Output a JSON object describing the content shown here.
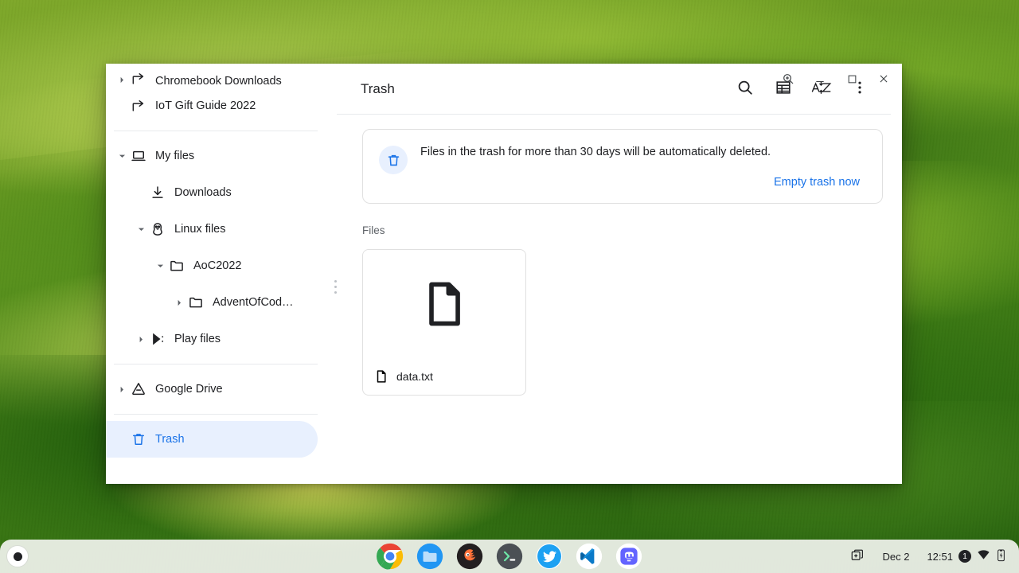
{
  "window": {
    "title": "Trash",
    "controls": [
      {
        "name": "zoom-window-button",
        "icon": "zoom-in-icon",
        "label": "Zoom"
      },
      {
        "name": "minimize-button",
        "icon": "minimize-icon",
        "label": "Minimize"
      },
      {
        "name": "maximize-button",
        "icon": "maximize-icon",
        "label": "Maximize"
      },
      {
        "name": "close-button",
        "icon": "close-icon",
        "label": "Close"
      }
    ]
  },
  "sidebar": {
    "items": [
      {
        "label": "Chromebook Downloads",
        "icon": "share-arrow-icon",
        "indent": 0,
        "state": "clipped",
        "twisty": "collapsed",
        "selected": false
      },
      {
        "label": "IoT Gift Guide 2022",
        "icon": "share-arrow-icon",
        "indent": 0,
        "state": "normal",
        "twisty": "none",
        "selected": false
      },
      {
        "label": "My files",
        "icon": "laptop-icon",
        "indent": 0,
        "state": "normal",
        "twisty": "expanded",
        "selected": false
      },
      {
        "label": "Downloads",
        "icon": "download-icon",
        "indent": 1,
        "state": "normal",
        "twisty": "none",
        "selected": false
      },
      {
        "label": "Linux files",
        "icon": "linux-penguin-icon",
        "indent": 1,
        "state": "normal",
        "twisty": "expanded",
        "selected": false
      },
      {
        "label": "AoC2022",
        "icon": "folder-icon",
        "indent": 2,
        "state": "normal",
        "twisty": "expanded",
        "selected": false
      },
      {
        "label": "AdventOfCod…",
        "icon": "folder-icon",
        "indent": 3,
        "state": "normal",
        "twisty": "collapsed",
        "selected": false
      },
      {
        "label": "Play files",
        "icon": "play-store-icon",
        "indent": 1,
        "state": "normal",
        "twisty": "collapsed",
        "selected": false
      },
      {
        "label": "Google Drive",
        "icon": "google-drive-icon",
        "indent": 0,
        "state": "normal",
        "twisty": "collapsed",
        "selected": false
      },
      {
        "label": "Trash",
        "icon": "trash-icon",
        "indent": 0,
        "state": "normal",
        "twisty": "none",
        "selected": true
      }
    ],
    "separator_after_indices": [
      1,
      7,
      8
    ]
  },
  "toolbar": {
    "title": "Trash",
    "search_label": "Search",
    "view_toggle_label": "Switch to list view",
    "sort_label": "A Z",
    "more_label": "More…"
  },
  "banner": {
    "icon": "trash-icon",
    "text": "Files in the trash for more than 30 days will be automatically deleted.",
    "action_label": "Empty trash now",
    "accent_color": "#1a73e8"
  },
  "content": {
    "section_label": "Files",
    "files": [
      {
        "name": "data.txt",
        "thumb_icon": "generic-file-icon"
      }
    ]
  },
  "shelf": {
    "launcher_label": "Launcher",
    "apps": [
      {
        "name": "chrome",
        "label": "Google Chrome",
        "running": true
      },
      {
        "name": "files",
        "label": "Files",
        "running": true,
        "active": true
      },
      {
        "name": "firefox-app",
        "label": "Firefox",
        "running": true
      },
      {
        "name": "terminal",
        "label": "Terminal",
        "running": true
      },
      {
        "name": "twitter",
        "label": "Twitter",
        "running": true
      },
      {
        "name": "vscode",
        "label": "Visual Studio Code",
        "running": true
      },
      {
        "name": "mastodon",
        "label": "Mastodon",
        "running": true
      }
    ],
    "status": {
      "desk_icon_label": "Desks",
      "date": "Dec 2",
      "time": "12:51",
      "notification_count": "1",
      "network_icon": "wifi-icon",
      "battery_icon": "battery-charging-icon"
    }
  }
}
